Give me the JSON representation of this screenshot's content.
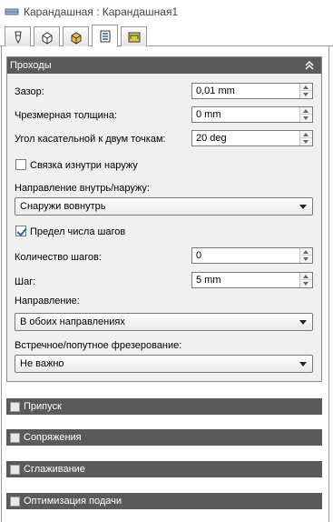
{
  "window": {
    "title": "Карандашная : Карандашная1"
  },
  "tabs": [
    {
      "icon": "tool-icon"
    },
    {
      "icon": "cube-outline-icon"
    },
    {
      "icon": "cube-solid-icon"
    },
    {
      "icon": "passes-icon",
      "active": true
    },
    {
      "icon": "linking-icon"
    }
  ],
  "passes": {
    "title": "Проходы",
    "gap_label": "Зазор:",
    "gap_value": "0,01 mm",
    "excess_label": "Чрезмерная толщина:",
    "excess_value": "0 mm",
    "angle_label": "Угол касательной к двум точкам:",
    "angle_value": "20 deg",
    "link_inside_out_label": "Связка изнутри наружу",
    "link_inside_out_checked": false,
    "direction_io_label": "Направление внутрь/наружу:",
    "direction_io_value": "Снаружи вовнутрь",
    "limit_steps_label": "Предел числа шагов",
    "limit_steps_checked": true,
    "step_count_label": "Количество шагов:",
    "step_count_value": "0",
    "step_label": "Шаг:",
    "step_value": "5 mm",
    "direction_label": "Направление:",
    "direction_value": "В обоих направлениях",
    "milling_label": "Встречное/попутное фрезерование:",
    "milling_value": "Не важно"
  },
  "sections": [
    {
      "label": "Припуск"
    },
    {
      "label": "Сопряжения"
    },
    {
      "label": "Сглаживание"
    },
    {
      "label": "Оптимизация подачи"
    }
  ],
  "colors": {
    "header_bg": "#5a5a5a",
    "panel_bg": "#f0f0f0",
    "check_mark": "#2a5cb8"
  }
}
